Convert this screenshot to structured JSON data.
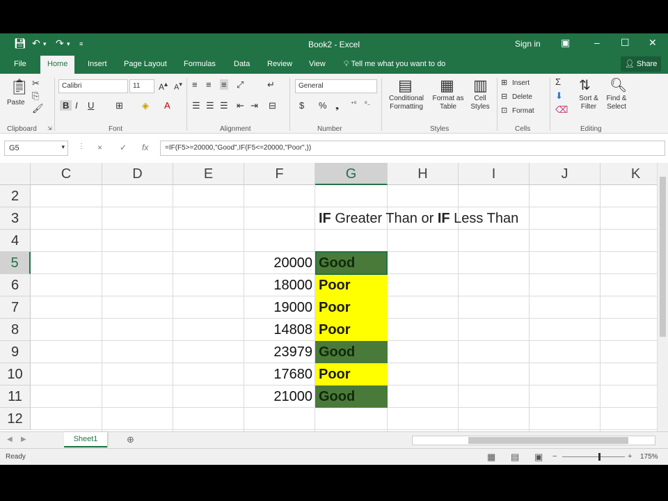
{
  "window": {
    "title": "Book2 - Excel",
    "sign_in": "Sign in",
    "qa_save_icon": "save-icon",
    "qa_undo_icon": "undo-icon",
    "qa_redo_icon": "redo-icon"
  },
  "tabs": {
    "file": "File",
    "home": "Home",
    "insert": "Insert",
    "page_layout": "Page Layout",
    "formulas": "Formulas",
    "data": "Data",
    "review": "Review",
    "view": "View",
    "tell_me": "Tell me what you want to do",
    "share": "Share"
  },
  "ribbon": {
    "clipboard": {
      "paste": "Paste",
      "label": "Clipboard"
    },
    "font": {
      "name": "Calibri",
      "size": "11",
      "label": "Font"
    },
    "alignment": {
      "label": "Alignment"
    },
    "number": {
      "format": "General",
      "label": "Number"
    },
    "styles": {
      "conditional_formatting": "Conditional\nFormatting",
      "format_as_table": "Format as\nTable",
      "cell_styles": "Cell\nStyles",
      "label": "Styles"
    },
    "cells": {
      "insert": "Insert",
      "delete": "Delete",
      "format": "Format",
      "label": "Cells"
    },
    "editing": {
      "sort_filter": "Sort &\nFilter",
      "find_select": "Find &\nSelect",
      "label": "Editing"
    }
  },
  "formula_bar": {
    "name_box": "G5",
    "cancel": "×",
    "enter": "✓",
    "fx": "fx",
    "formula": "=IF(F5>=20000,\"Good\",IF(F5<=20000,\"Poor\",))"
  },
  "grid": {
    "columns": [
      "C",
      "D",
      "E",
      "F",
      "G",
      "H",
      "I",
      "J",
      "K"
    ],
    "rows": [
      "2",
      "3",
      "4",
      "5",
      "6",
      "7",
      "8",
      "9",
      "10",
      "11",
      "12"
    ],
    "heading": {
      "if1": "IF",
      "mid": " Greater Than or ",
      "if2": "IF",
      "end": " Less Than"
    },
    "values": [
      "20000",
      "18000",
      "19000",
      "14808",
      "23979",
      "17680",
      "21000"
    ],
    "results": [
      "Good",
      "Poor",
      "Poor",
      "Poor",
      "Good",
      "Poor",
      "Good"
    ],
    "colors": {
      "good_fill": "#4a7a3a",
      "good_text": "#0f2a0a",
      "poor_fill": "#ffff00",
      "poor_text": "#1a1a1a"
    }
  },
  "sheets": {
    "active": "Sheet1"
  },
  "status": {
    "ready": "Ready",
    "zoom": "175%"
  }
}
